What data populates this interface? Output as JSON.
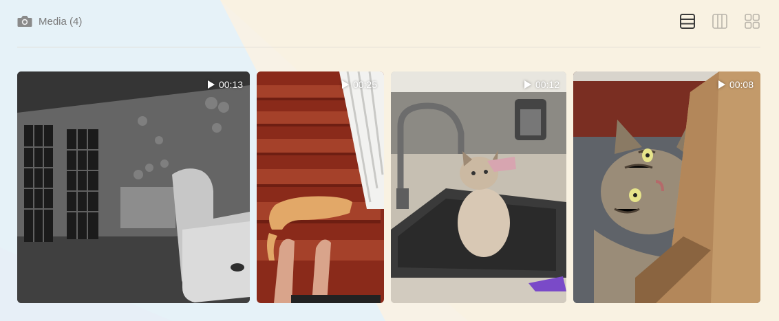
{
  "header": {
    "title": "Media (4)",
    "icon": "camera-icon",
    "view_modes": [
      {
        "name": "rows-view",
        "icon": "rows-icon",
        "active": true
      },
      {
        "name": "columns-view",
        "icon": "columns-icon",
        "active": false
      },
      {
        "name": "grid-view",
        "icon": "grid-icon",
        "active": false
      }
    ]
  },
  "media": [
    {
      "duration": "00:13",
      "thumbnail": "night-vision living room with french doors and recliner"
    },
    {
      "duration": "00:25",
      "thumbnail": "orange cat on wooden staircase stepping over a foot"
    },
    {
      "duration": "00:12",
      "thumbnail": "siamese cat sitting in kitchen sink below faucet"
    },
    {
      "duration": "00:08",
      "thumbnail": "tabby cat peeking out from cardboard box"
    }
  ],
  "colors": {
    "icon_active": "#3a3a3a",
    "icon_inactive": "#b8b3a9",
    "text_muted": "#7a7a7a",
    "divider": "#e2ded6"
  }
}
